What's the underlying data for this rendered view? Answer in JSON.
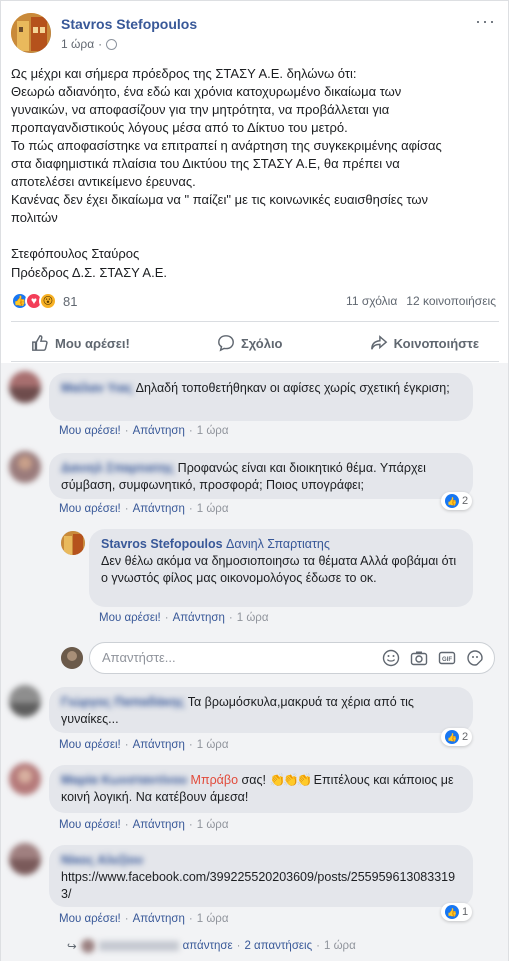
{
  "post": {
    "author": "Stavros Stefopoulos",
    "time": "1 ώρα",
    "more_label": "···",
    "text_lines": [
      "Ως μέχρι και σήμερα πρόεδρος της ΣΤΑΣΥ Α.Ε. δηλώνω ότι:",
      "Θεωρώ αδιανόητο, ένα εδώ και χρόνια κατοχυρωμένο δικαίωμα των",
      "γυναικών, να αποφασίζουν για την μητρότητα, να προβάλλεται για",
      "προπαγανδιστικούς λόγους μέσα από το Δίκτυο του μετρό.",
      "Το πώς αποφασίστηκε να επιτραπεί η ανάρτηση της συγκεκριμένης αφίσας",
      "στα διαφημιστικά πλαίσια του Δικτύου της ΣΤΑΣΥ Α.Ε, θα πρέπει να",
      "αποτελέσει αντικείμενο έρευνας.",
      "Κανένας δεν έχει δικαίωμα να \" παίζει\" με τις κοινωνικές ευαισθησίες των",
      "πολιτών"
    ],
    "signature": [
      "Στεφόπουλος Σταύρος",
      "Πρόεδρος Δ.Σ. ΣΤΑΣΥ Α.Ε."
    ],
    "reaction_count": "81",
    "comments_count": "11 σχόλια",
    "shares_count": "12 κοινοποιήσεις"
  },
  "actions": {
    "like": "Μου αρέσει!",
    "comment": "Σχόλιο",
    "share": "Κοινοποιήστε"
  },
  "common": {
    "like": "Μου αρέσει!",
    "reply": "Απάντηση",
    "sep": "·",
    "time": "1 ώρα"
  },
  "comments": [
    {
      "name": "Μαίλαν Υιας",
      "text": "Δηλαδή τοποθετήθηκαν οι αφίσες χωρίς σχετική έγκριση;"
    },
    {
      "name": "Δανιηλ Σπαρτιατης",
      "text": "Προφανώς είναι και διοικητικό θέμα. Υπάρχει σύμβαση, συμφωνητικό, προσφορά; Ποιος υπογράφει;",
      "reactions": "2"
    },
    {
      "name": "Stavros Stefopoulos",
      "mention": "Δανιηλ Σπαρτιατης",
      "text": "Δεν θέλω ακόμα να δημοσιοποιησω τα θέματα Αλλά φοβάμαι ότι ο γνωστός φίλος μας οικονομολόγος έδωσε το οκ."
    },
    {
      "name": "Γιώργος Παπαδάκης",
      "text": "Τα βρωμόσκυλα,μακρυά τα χέρια από τις γυναίκες...",
      "reactions": "2"
    },
    {
      "name": "Μαρία Κωνσταντίνου",
      "highlight": "Μπράβο",
      "text_after": "σας!",
      "emoji": "👏👏👏",
      "text": "Επιτέλους και κάποιος με κοινή λογική. Να κατέβουν άμεσα!"
    },
    {
      "name": "Νίκος Αλεξίου",
      "text": "https://www.facebook.com/399225520203609/posts/2559596130833193/",
      "reactions": "1"
    }
  ],
  "reply_input": {
    "placeholder": "Απαντήστε..."
  },
  "replies_footer": {
    "label": "απάντησε",
    "count": "2 απαντήσεις",
    "time": "1 ώρα"
  },
  "colors": {
    "link": "#385898",
    "like_blue": "#1877f2",
    "bubble": "#e4e6eb"
  }
}
